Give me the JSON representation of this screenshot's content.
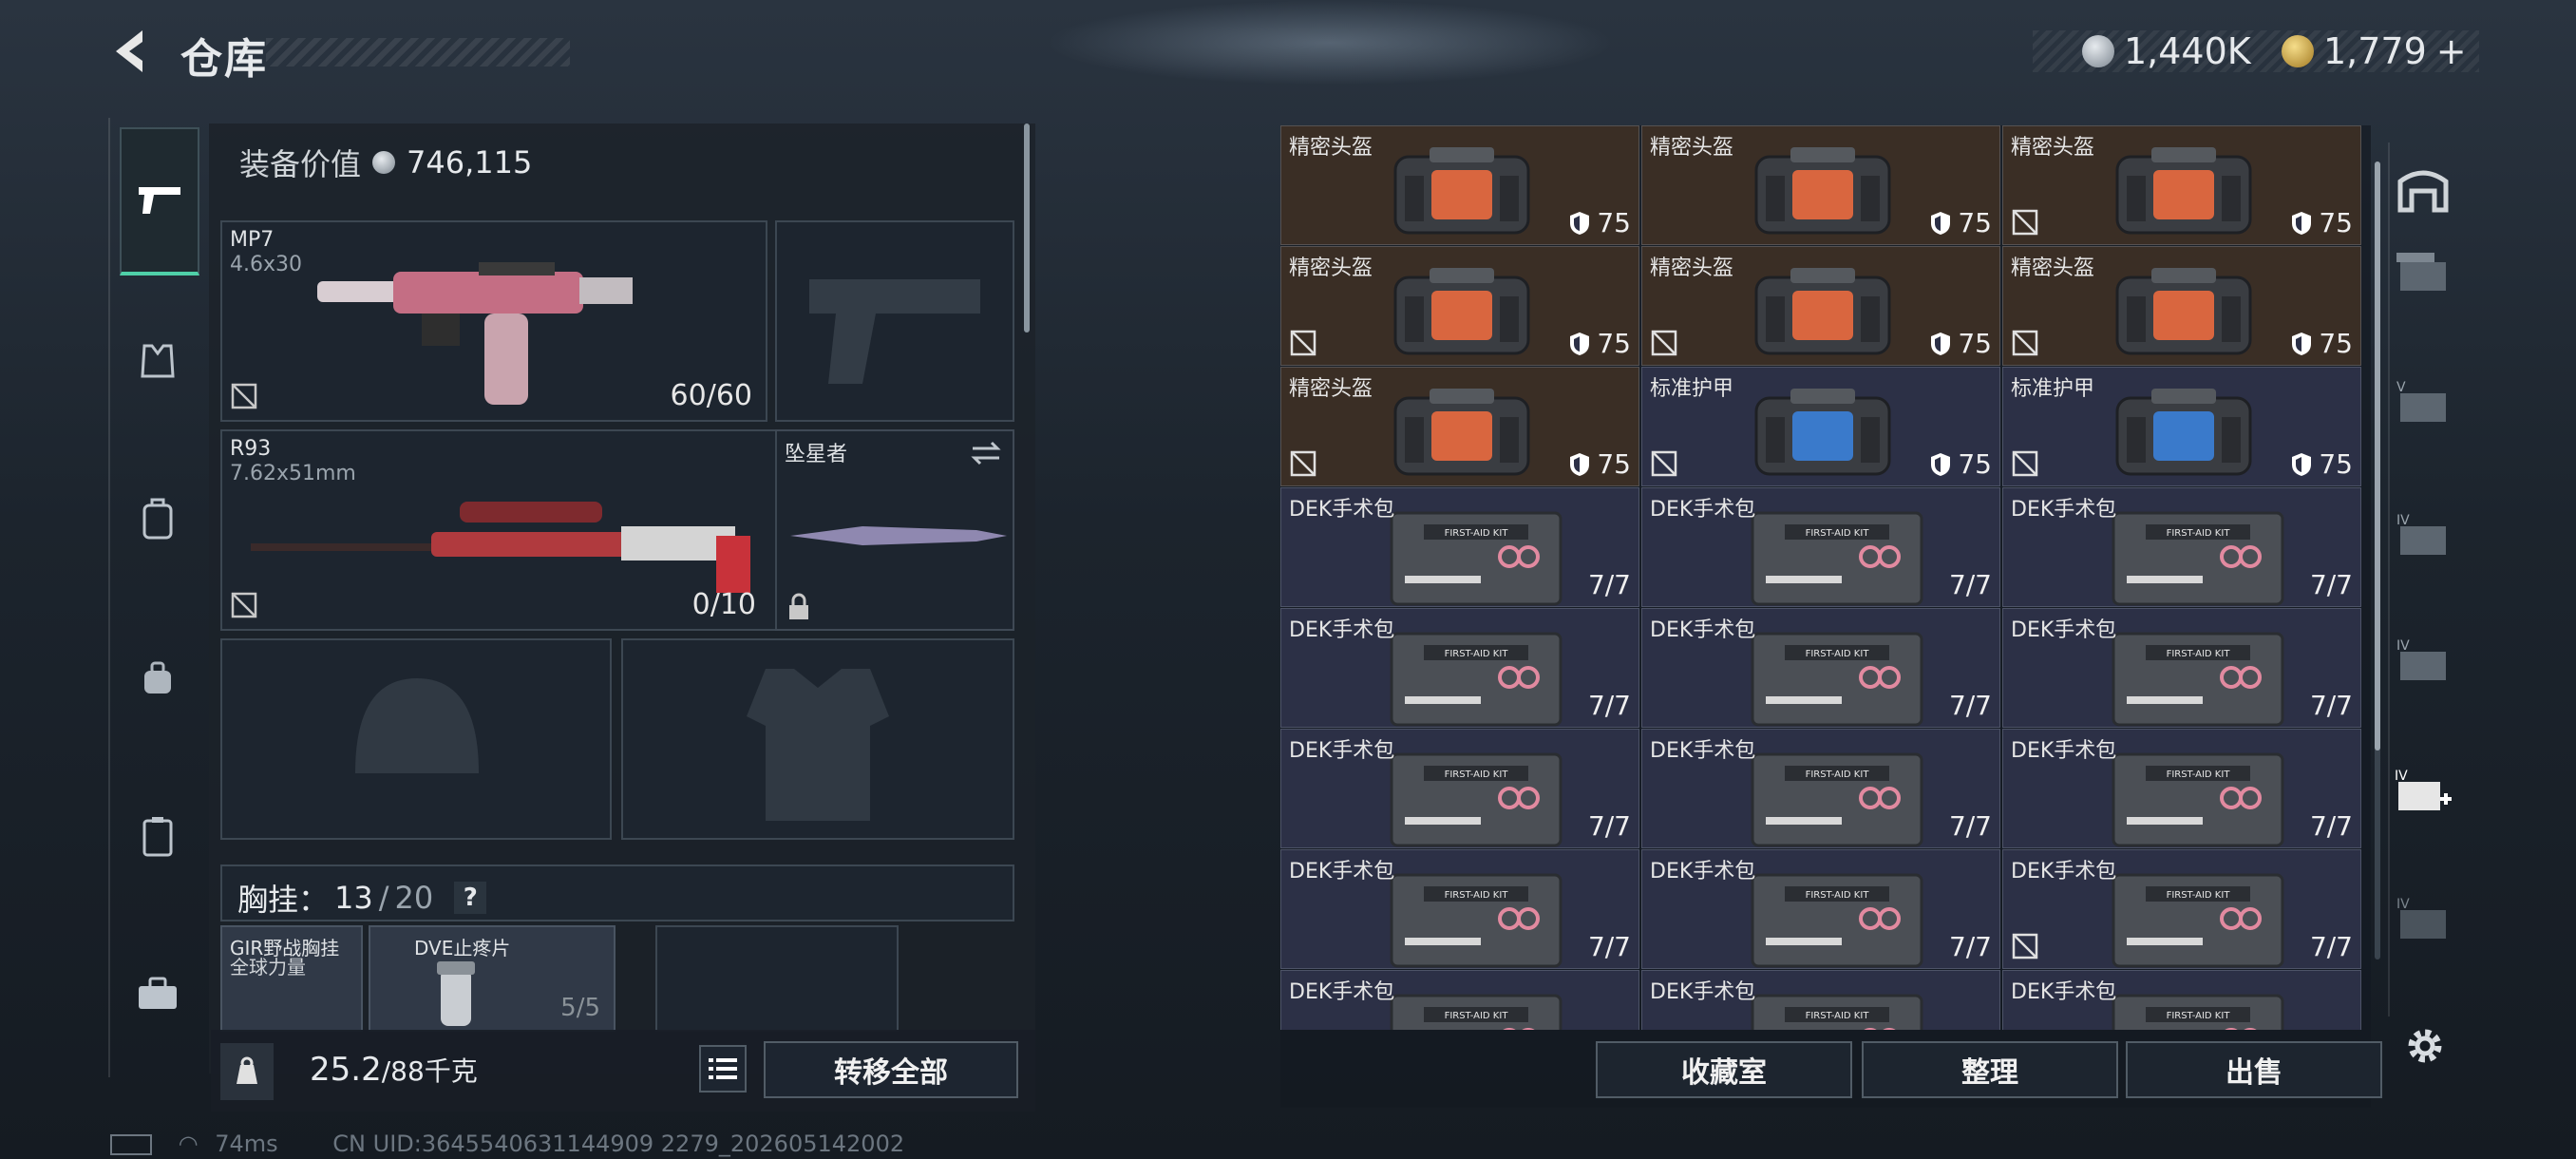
{
  "header": {
    "title": "仓库"
  },
  "currency": [
    {
      "value": "1,440K",
      "icon": "silver-coin-icon",
      "color": "#b8c0c8"
    },
    {
      "value": "1,779",
      "icon": "gold-coin-icon",
      "color": "#d6b256",
      "plus": "+"
    }
  ],
  "loadout": {
    "value_label": "装备价值",
    "value": "746,115",
    "primary": {
      "name": "MP7",
      "ammo": "4.6x30",
      "count": "60/60"
    },
    "secondary": {
      "name": "R93",
      "ammo": "7.62x51mm",
      "count": "0/10"
    },
    "melee": {
      "name": "坠星者"
    },
    "rig_label": "胸挂：",
    "rig_used": "13",
    "rig_sep": "/",
    "rig_total": "20",
    "rig_help": "?",
    "rig_items": [
      {
        "name": "GIR野战胸挂",
        "sub": "全球力量"
      },
      {
        "name": "DVE止疼片",
        "count": "5/5"
      }
    ],
    "weight": "25.2",
    "weight_total": "/88千克",
    "transfer_all": "转移全部"
  },
  "inventory": {
    "rows": [
      [
        {
          "label": "精密头盔",
          "dur": "75",
          "kind": "helmet",
          "bg": "brown",
          "nd": false
        },
        {
          "label": "精密头盔",
          "dur": "75",
          "kind": "helmet",
          "bg": "brown",
          "nd": false
        },
        {
          "label": "精密头盔",
          "dur": "75",
          "kind": "helmet",
          "bg": "brown",
          "nd": true
        }
      ],
      [
        {
          "label": "精密头盔",
          "dur": "75",
          "kind": "helmet",
          "bg": "brown",
          "nd": true
        },
        {
          "label": "精密头盔",
          "dur": "75",
          "kind": "helmet",
          "bg": "brown",
          "nd": true
        },
        {
          "label": "精密头盔",
          "dur": "75",
          "kind": "helmet",
          "bg": "brown",
          "nd": true
        }
      ],
      [
        {
          "label": "精密头盔",
          "dur": "75",
          "kind": "helmet",
          "bg": "brown",
          "nd": true
        },
        {
          "label": "标准护甲",
          "dur": "75",
          "kind": "armor",
          "bg": "blue",
          "nd": true
        },
        {
          "label": "标准护甲",
          "dur": "75",
          "kind": "armor",
          "bg": "blue",
          "nd": true
        }
      ],
      [
        {
          "label": "DEK手术包",
          "dur": "7/7",
          "kind": "kit",
          "bg": "blue",
          "nd": false
        },
        {
          "label": "DEK手术包",
          "dur": "7/7",
          "kind": "kit",
          "bg": "blue",
          "nd": false
        },
        {
          "label": "DEK手术包",
          "dur": "7/7",
          "kind": "kit",
          "bg": "blue",
          "nd": false
        }
      ],
      [
        {
          "label": "DEK手术包",
          "dur": "7/7",
          "kind": "kit",
          "bg": "blue",
          "nd": false
        },
        {
          "label": "DEK手术包",
          "dur": "7/7",
          "kind": "kit",
          "bg": "blue",
          "nd": false
        },
        {
          "label": "DEK手术包",
          "dur": "7/7",
          "kind": "kit",
          "bg": "blue",
          "nd": false
        }
      ],
      [
        {
          "label": "DEK手术包",
          "dur": "7/7",
          "kind": "kit",
          "bg": "blue",
          "nd": false
        },
        {
          "label": "DEK手术包",
          "dur": "7/7",
          "kind": "kit",
          "bg": "blue",
          "nd": false
        },
        {
          "label": "DEK手术包",
          "dur": "7/7",
          "kind": "kit",
          "bg": "blue",
          "nd": false
        }
      ],
      [
        {
          "label": "DEK手术包",
          "dur": "7/7",
          "kind": "kit",
          "bg": "blue",
          "nd": false
        },
        {
          "label": "DEK手术包",
          "dur": "7/7",
          "kind": "kit",
          "bg": "blue",
          "nd": false
        },
        {
          "label": "DEK手术包",
          "dur": "7/7",
          "kind": "kit",
          "bg": "blue",
          "nd": true
        }
      ],
      [
        {
          "label": "DEK手术包",
          "dur": "",
          "kind": "kit",
          "bg": "blue",
          "nd": false
        },
        {
          "label": "DEK手术包",
          "dur": "",
          "kind": "kit",
          "bg": "blue",
          "nd": false
        },
        {
          "label": "DEK手术包",
          "dur": "",
          "kind": "kit",
          "bg": "blue",
          "nd": false
        }
      ]
    ],
    "kit_text": "FIRST-AID KIT"
  },
  "actions": {
    "collection": "收藏室",
    "organize": "整理",
    "sell": "出售"
  },
  "status": {
    "ping": "74ms",
    "uid": "CN UID:3645540631144909 2279_202605142002"
  }
}
